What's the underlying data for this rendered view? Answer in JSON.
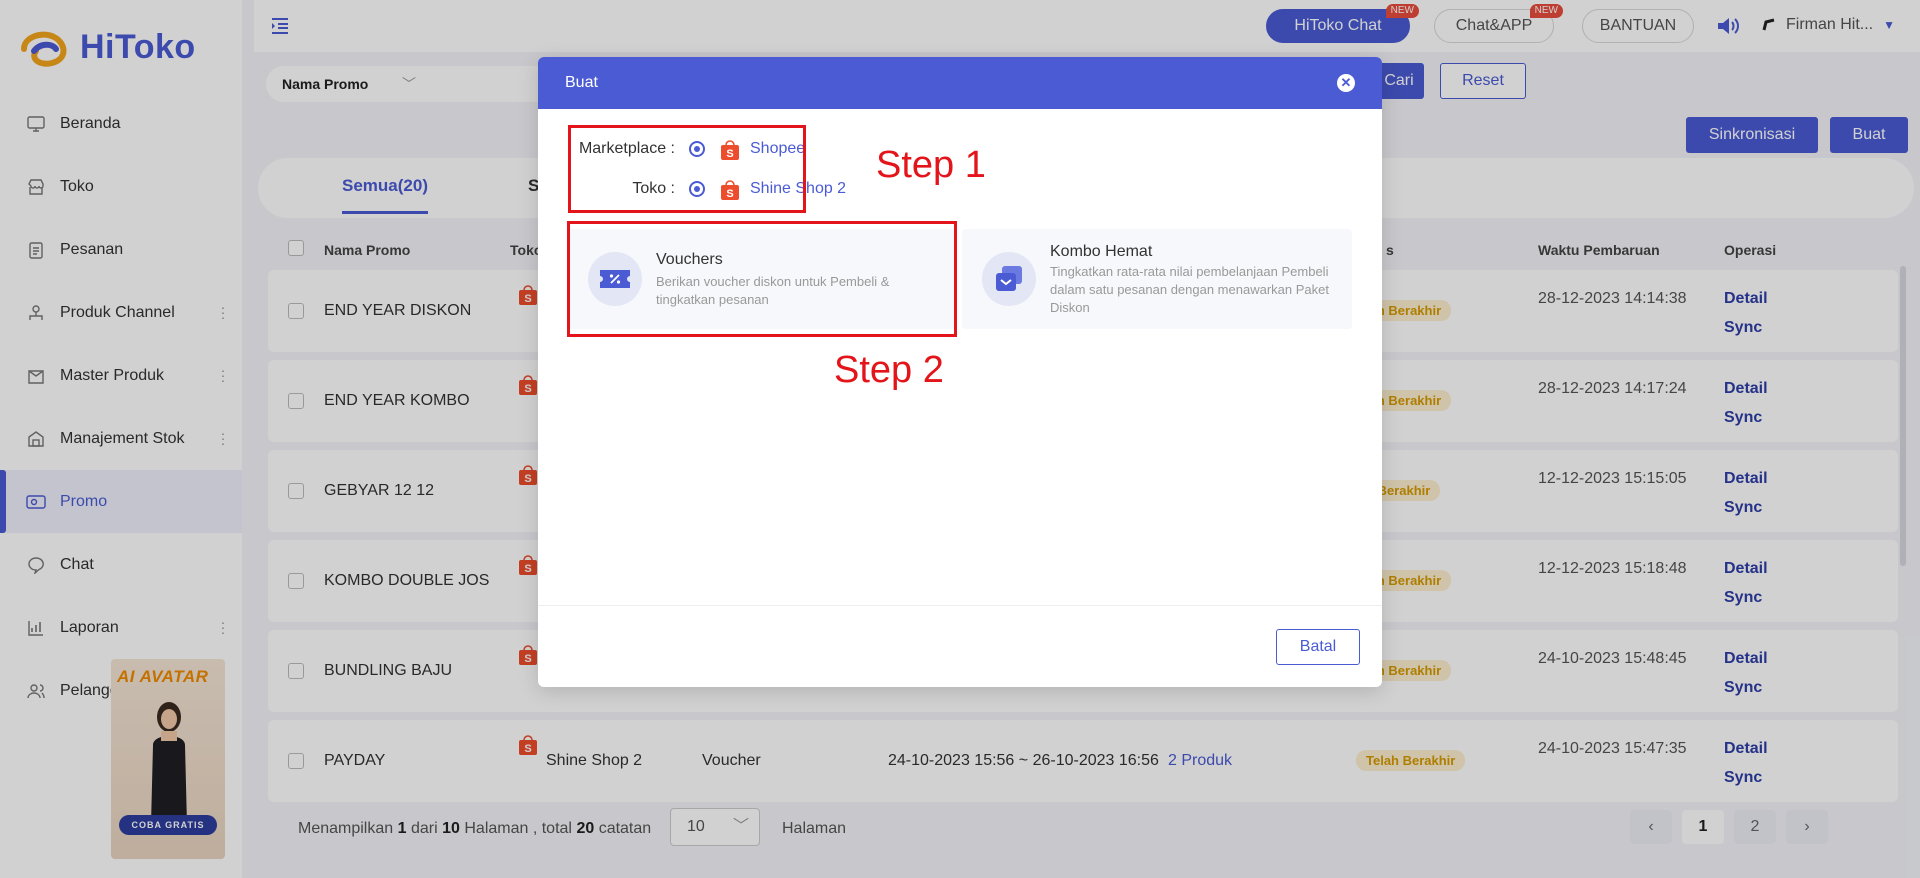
{
  "brand": {
    "name": "HiToko"
  },
  "sidebar": {
    "items": [
      {
        "label": "Beranda",
        "icon": "monitor-icon",
        "has_menu": false
      },
      {
        "label": "Toko",
        "icon": "store-icon",
        "has_menu": false
      },
      {
        "label": "Pesanan",
        "icon": "clipboard-icon",
        "has_menu": false
      },
      {
        "label": "Produk Channel",
        "icon": "channel-icon",
        "has_menu": true
      },
      {
        "label": "Master Produk",
        "icon": "box-icon",
        "has_menu": true
      },
      {
        "label": "Manajement Stok",
        "icon": "warehouse-icon",
        "has_menu": true
      },
      {
        "label": "Promo",
        "icon": "ticket-icon",
        "has_menu": false,
        "active": true
      },
      {
        "label": "Chat",
        "icon": "chat-icon",
        "has_menu": false
      },
      {
        "label": "Laporan",
        "icon": "chart-icon",
        "has_menu": true
      },
      {
        "label": "Pelanggan",
        "icon": "users-icon",
        "has_menu": false
      }
    ],
    "ai_banner": {
      "title": "AI AVATAR",
      "button": "COBA GRATIS"
    }
  },
  "topbar": {
    "hitoko_chat": "HiToko Chat",
    "chat_app": "Chat&APP",
    "bantuan": "BANTUAN",
    "new_badge": "NEW",
    "user_name": "Firman Hit..."
  },
  "filter": {
    "field_label": "Nama Promo",
    "search_button": "Cari",
    "reset_button": "Reset",
    "sync_button": "Sinkronisasi",
    "create_button": "Buat"
  },
  "tabs": [
    {
      "label": "Semua(20)",
      "active": true
    },
    {
      "label": "S",
      "active": false
    }
  ],
  "table": {
    "headers": {
      "name": "Nama Promo",
      "shop": "Toko",
      "status": "s",
      "updated": "Waktu Pembaruan",
      "op": "Operasi"
    },
    "detail_label": "Detail",
    "sync_label": "Sync",
    "rows": [
      {
        "name": "END YEAR DISKON",
        "status": "lah Berakhir",
        "updated": "28-12-2023 14:14:38"
      },
      {
        "name": "END YEAR KOMBO",
        "status": "lah Berakhir",
        "updated": "28-12-2023 14:17:24"
      },
      {
        "name": "GEBYAR 12 12",
        "status": "h Berakhir",
        "updated": "12-12-2023 15:15:05"
      },
      {
        "name": "KOMBO DOUBLE JOS",
        "status": "lah Berakhir",
        "updated": "12-12-2023 15:18:48"
      },
      {
        "name": "BUNDLING BAJU",
        "status": "lah Berakhir",
        "updated": "24-10-2023 15:48:45"
      },
      {
        "name": "PAYDAY",
        "shop": "Shine Shop 2",
        "type": "Voucher",
        "period": "24-10-2023 15:56 ~ 26-10-2023 16:56",
        "products": "2 Produk",
        "status": "Telah Berakhir",
        "updated": "24-10-2023 15:47:35"
      }
    ]
  },
  "pager": {
    "prefix": "Menampilkan",
    "current": "1",
    "of": "dari",
    "total_pages": "10",
    "pages_word": "Halaman ,",
    "total_word": "total",
    "total_records": "20",
    "records_word": "catatan",
    "page_size": "10",
    "page_label": "Halaman",
    "pages": [
      "1",
      "2"
    ]
  },
  "modal": {
    "title": "Buat",
    "marketplace_label": "Marketplace :",
    "marketplace_value": "Shopee",
    "shop_label": "Toko :",
    "shop_value": "Shine Shop 2",
    "step1": "Step 1",
    "step2": "Step 2",
    "options": [
      {
        "title": "Vouchers",
        "desc": "Berikan voucher diskon untuk Pembeli & tingkatkan pesanan"
      },
      {
        "title": "Kombo Hemat",
        "desc": "Tingkatkan rata-rata nilai pembelanjaan Pembeli dalam satu pesanan dengan menawarkan Paket Diskon"
      }
    ],
    "cancel": "Batal"
  },
  "colors": {
    "primary": "#4a5bd4",
    "annotation": "#e3151a",
    "shopee": "#ee4d2d"
  }
}
